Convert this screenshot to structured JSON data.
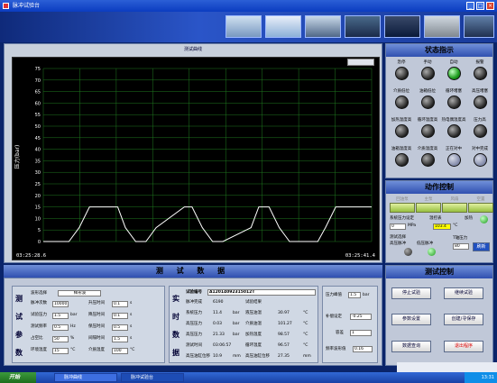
{
  "window": {
    "title": "脉冲试验台"
  },
  "chart": {
    "panel_title": "测试曲线",
    "y_axis_title": "压力(bar)",
    "time_start": "03:25:28.6",
    "time_end": "03:25:41.4"
  },
  "chart_data": {
    "type": "line",
    "title": "测试曲线",
    "ylabel": "压力(bar)",
    "y_ticks": [
      "75",
      "70",
      "65",
      "60",
      "55",
      "50",
      "45",
      "40",
      "35",
      "30",
      "25",
      "20",
      "15",
      "10",
      "5",
      "0"
    ],
    "ylim": [
      0,
      75
    ],
    "x_range": [
      "03:25:28.6",
      "03:25:41.4"
    ],
    "grid": true,
    "series": [
      {
        "color": "#ffffff",
        "t_sec": [
          0,
          1.0,
          1.4,
          1.8,
          2.9,
          3.2,
          3.6,
          4.0,
          4.4,
          5.5,
          5.8,
          6.2,
          6.6,
          7.0,
          8.1,
          8.4,
          8.8,
          9.2,
          9.6,
          10.7,
          11.0,
          11.4,
          12.8
        ],
        "values": [
          0,
          0,
          6,
          15,
          15,
          6,
          0,
          0,
          6,
          15,
          15,
          6,
          0,
          0,
          6,
          15,
          15,
          6,
          0,
          0,
          6,
          15,
          15
        ]
      }
    ]
  },
  "status": {
    "title": "状态指示",
    "indicators": [
      {
        "label": "急停",
        "state": "off"
      },
      {
        "label": "手动",
        "state": "off"
      },
      {
        "label": "自动",
        "state": "on"
      },
      {
        "label": "报警",
        "state": "off"
      },
      {
        "label": "介质低位",
        "state": "off"
      },
      {
        "label": "油箱低位",
        "state": "off"
      },
      {
        "label": "循环堵塞",
        "state": "off"
      },
      {
        "label": "高压堵塞",
        "state": "off"
      },
      {
        "label": "加热温度高",
        "state": "off"
      },
      {
        "label": "循环温度高",
        "state": "off"
      },
      {
        "label": "热电偶温度高",
        "state": "off"
      },
      {
        "label": "压力高",
        "state": "off"
      },
      {
        "label": "油箱温度高",
        "state": "off"
      },
      {
        "label": "介质温度高",
        "state": "off"
      },
      {
        "label": "正在对中",
        "state": "idle"
      },
      {
        "label": "对中完成",
        "state": "idle"
      }
    ]
  },
  "action": {
    "title": "动作控制",
    "switches": [
      "回油泵",
      "主泵",
      "风扇",
      "空置"
    ],
    "pressure_set_label": "系统压力设定",
    "pressure_set_value": "0",
    "pressure_unit": "MPa",
    "temp_set_label": "温控表",
    "temp_set_value": "103.4",
    "temp_unit": "°C",
    "heat_label": "加热",
    "test_select_label": "测试选择",
    "high_pulse": "高压脉冲",
    "low_pulse": "低压脉冲",
    "limit_pressure_label": "T轴压力",
    "limit_value": "80",
    "refresh_label": "刷新"
  },
  "test_control": {
    "title": "测试控制",
    "buttons": [
      "停止试验",
      "继续试验",
      "参数设置",
      "创建/寻保存",
      "数据查询",
      "退出程序"
    ]
  },
  "data_section": {
    "title": "测 试 数 据"
  },
  "params": {
    "title": "测试参数",
    "wave_label": "波形选择",
    "wave_value": "梯形波",
    "rows": [
      {
        "l1": "脉冲次数",
        "v1": "10000",
        "u1": "",
        "l2": "升压时间",
        "v2": "0.1",
        "u2": "s"
      },
      {
        "l1": "试验压力",
        "v1": "1.5",
        "u1": "bar",
        "l2": "降压时间",
        "v2": "0.1",
        "u2": "s"
      },
      {
        "l1": "测试频率",
        "v1": "0.5",
        "u1": "Hz",
        "l2": "保压时间",
        "v2": "0.5",
        "u2": "s"
      },
      {
        "l1": "占空比",
        "v1": "50",
        "u1": "%",
        "l2": "间隔时间",
        "v2": "1.5",
        "u2": "s"
      },
      {
        "l1": "环境温度",
        "v1": "15",
        "u1": "°C",
        "l2": "介质温度",
        "v2": "100",
        "u2": "°C"
      }
    ]
  },
  "realtime": {
    "title": "实时数据",
    "serial_label": "试验编号",
    "serial_value": "A12014092315012T",
    "rows": [
      {
        "l1": "脉冲完成",
        "v1": "6190",
        "l2": "试验结果",
        "v2": ""
      },
      {
        "l1": "系统压力",
        "v1": "11.4",
        "u1": "bar",
        "l2": "液压油温",
        "v2": "30.97",
        "u2": "°C"
      },
      {
        "l1": "高压压力",
        "v1": "0.03",
        "u1": "bar",
        "l2": "介质油温",
        "v2": "101.27",
        "u2": "°C"
      },
      {
        "l1": "高压压力",
        "v1": "21.33",
        "u1": "bar",
        "l2": "加热温度",
        "v2": "98.57",
        "u2": "°C"
      },
      {
        "l1": "测试时间",
        "v1": "03:06:57",
        "u1": "",
        "l2": "循环温度",
        "v2": "96.57",
        "u2": "°C"
      },
      {
        "l1": "高压油缸位移",
        "v1": "10.9",
        "u1": "mm",
        "l2": "高压油缸位移",
        "v2": "27.35",
        "u2": "mm"
      }
    ]
  },
  "peak": {
    "peak_label": "压力峰值",
    "peak_value": "1.5",
    "peak_unit": "bar",
    "comp_label": "补偿设定",
    "comp_value": "-0.25",
    "tol_label": "容差",
    "tol_value": "1",
    "freq_label": "频率波形值",
    "freq_value": "0.16"
  },
  "taskbar": {
    "start_label": "开始",
    "items": [
      "脉冲曲线",
      "脉冲试验台"
    ],
    "clock": "13:31"
  }
}
